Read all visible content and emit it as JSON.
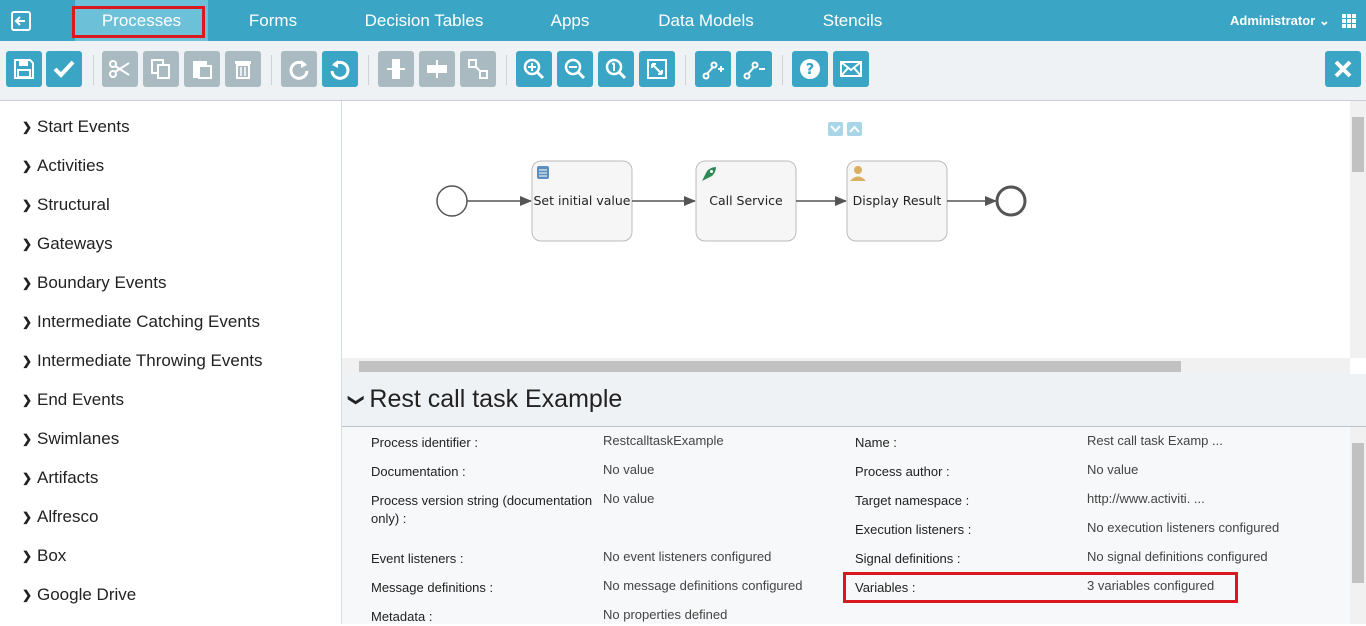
{
  "nav": {
    "tabs": [
      {
        "label": "Processes"
      },
      {
        "label": "Forms"
      },
      {
        "label": "Decision Tables"
      },
      {
        "label": "Apps"
      },
      {
        "label": "Data Models"
      },
      {
        "label": "Stencils"
      }
    ],
    "user": "Administrator"
  },
  "toolbar": {
    "buttons": [
      "save-icon",
      "validate-icon",
      "cut-icon",
      "copy-icon",
      "paste-icon",
      "delete-icon",
      "redo-icon",
      "undo-icon",
      "align-horizontal-icon",
      "align-vertical-icon",
      "same-size-icon",
      "zoom-in-icon",
      "zoom-out-icon",
      "zoom-actual-icon",
      "zoom-fit-icon",
      "bend-point-add-icon",
      "bend-point-remove-icon",
      "help-icon",
      "email-icon",
      "close-icon"
    ]
  },
  "palette": {
    "items": [
      {
        "label": "Start Events"
      },
      {
        "label": "Activities"
      },
      {
        "label": "Structural"
      },
      {
        "label": "Gateways"
      },
      {
        "label": "Boundary Events"
      },
      {
        "label": "Intermediate Catching Events"
      },
      {
        "label": "Intermediate Throwing Events"
      },
      {
        "label": "End Events"
      },
      {
        "label": "Swimlanes"
      },
      {
        "label": "Artifacts"
      },
      {
        "label": "Alfresco"
      },
      {
        "label": "Box"
      },
      {
        "label": "Google Drive"
      }
    ]
  },
  "diagram": {
    "tasks": [
      {
        "label": "Set initial value",
        "icon": "script-icon"
      },
      {
        "label": "Call Service",
        "icon": "rocket-icon"
      },
      {
        "label": "Display Result",
        "icon": "user-icon"
      }
    ]
  },
  "properties": {
    "title": "Rest call task Example",
    "left": [
      {
        "label": "Process identifier :",
        "value": "RestcalltaskExample"
      },
      {
        "label": "Documentation :",
        "value": "No value"
      },
      {
        "label": "Process version string (documentation only) :",
        "value": "No value"
      },
      {
        "label": "Event listeners :",
        "value": "No event listeners configured"
      },
      {
        "label": "Message definitions :",
        "value": "No message definitions configured"
      },
      {
        "label": "Metadata :",
        "value": "No properties defined"
      }
    ],
    "right": [
      {
        "label": "Name :",
        "value": "Rest call task Examp ..."
      },
      {
        "label": "Process author :",
        "value": "No value"
      },
      {
        "label": "Target namespace :",
        "value": "http://www.activiti. ..."
      },
      {
        "label": "Execution listeners :",
        "value": "No execution listeners configured"
      },
      {
        "label": "Signal definitions :",
        "value": "No signal definitions configured"
      },
      {
        "label": "Variables :",
        "value": "3 variables configured"
      }
    ]
  }
}
